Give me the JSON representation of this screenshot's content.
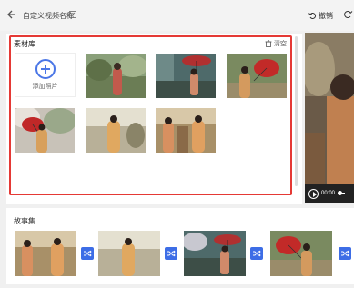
{
  "header": {
    "title": "自定义视频名称",
    "undo_label": "撤销"
  },
  "materials": {
    "title": "素材库",
    "clear_label": "清空",
    "add_label": "添加照片"
  },
  "preview": {
    "time": "00:00"
  },
  "story": {
    "title": "故事集"
  },
  "colors": {
    "accent": "#3d6de6",
    "highlight_border": "#e53935"
  }
}
